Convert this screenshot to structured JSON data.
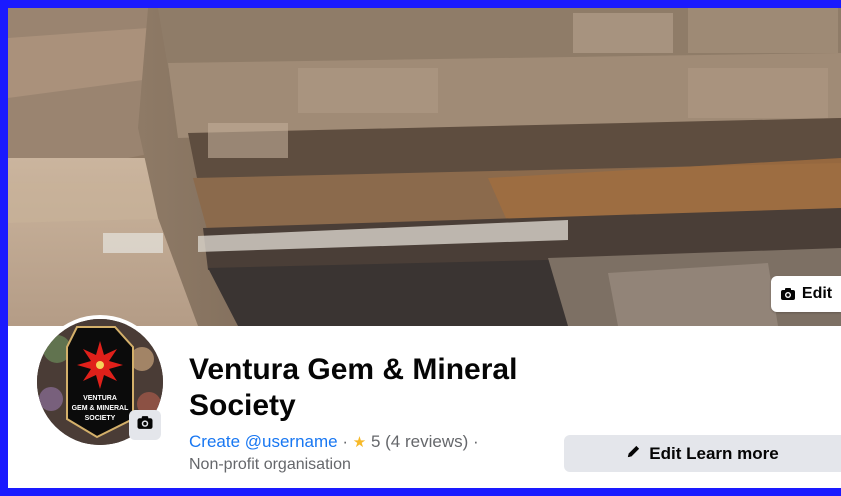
{
  "cover": {
    "edit_label": "Edit"
  },
  "avatar": {
    "logo_text": [
      "VENTURA",
      "GEM & MINERAL",
      "SOCIETY"
    ]
  },
  "page": {
    "name": "Ventura Gem & Mineral Society",
    "username_link": "Create @username",
    "separator": "·",
    "rating_value": "5",
    "rating_count": "(4 reviews)",
    "category": "Non-profit organisation"
  },
  "actions": {
    "edit_learn_more": "Edit Learn more"
  },
  "colors": {
    "frame": "#1a1aff",
    "link": "#1877f2",
    "star": "#f7b928",
    "button_bg": "#e4e6eb"
  }
}
